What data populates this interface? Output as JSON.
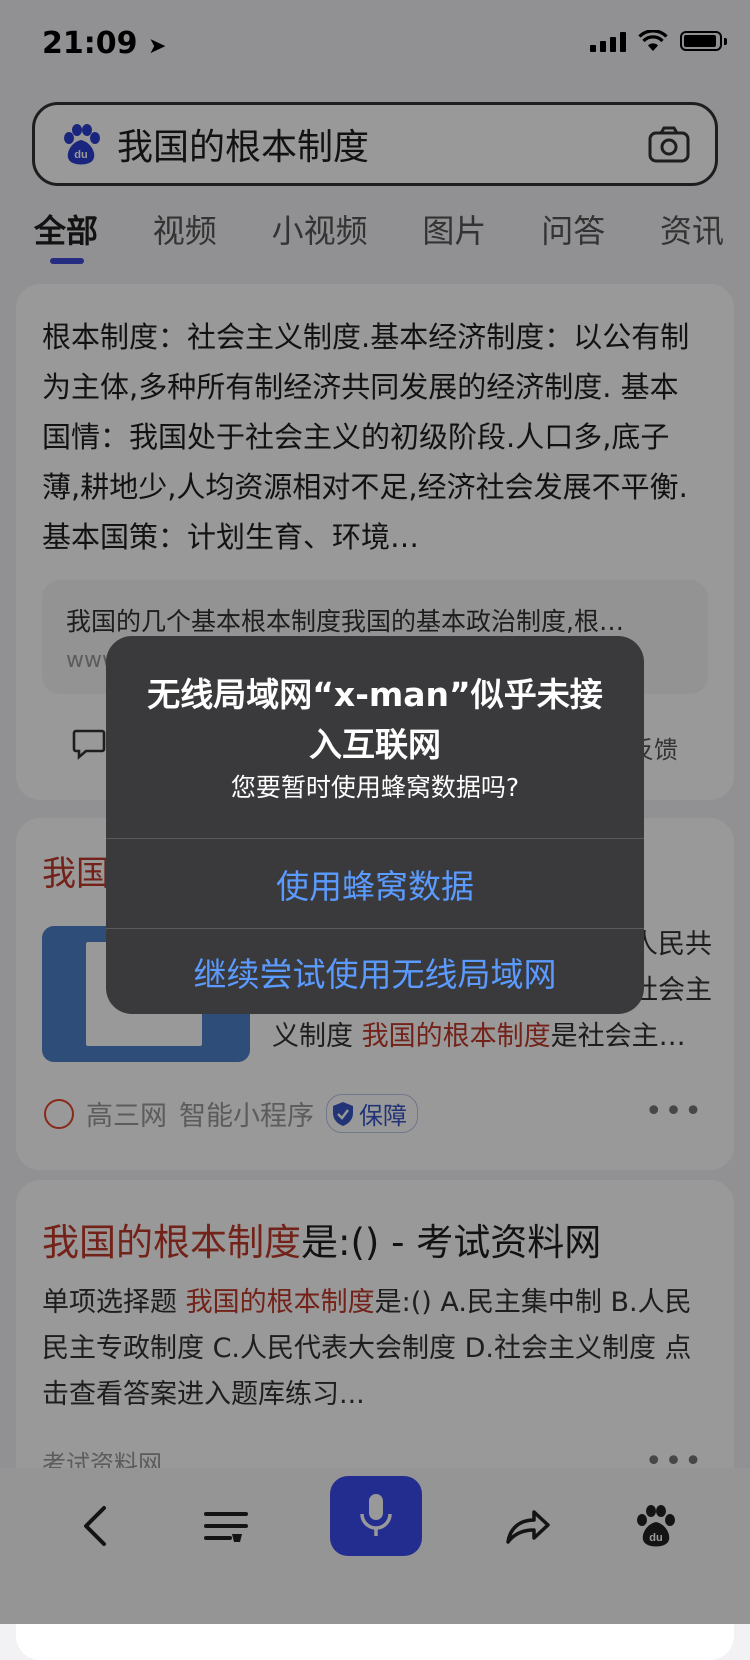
{
  "status_bar": {
    "time": "21:09"
  },
  "search": {
    "query": "我国的根本制度"
  },
  "tabs": [
    {
      "label": "全部"
    },
    {
      "label": "视频"
    },
    {
      "label": "小视频"
    },
    {
      "label": "图片"
    },
    {
      "label": "问答"
    },
    {
      "label": "资讯"
    }
  ],
  "result1": {
    "summary": "根本制度：社会主义制度.基本经济制度：以公有制为主体,多种所有制经济共同发展的经济制度. 基本国情：我国处于社会主义的初级阶段.人口多,底子薄,耕地少,人均资源相对不足,经济社会发展不平衡.基本国策：计划生育、环境…",
    "sub_text": "我国的几个基本根本制度我国的基本政治制度,根…",
    "sub_url": "www",
    "feedback": "反馈"
  },
  "result2": {
    "title": "我国",
    "line1": "人民共",
    "line2": "社会主",
    "line3_pre": "义制度 ",
    "line3_hl": "我国的根本制度",
    "line3_post": "是社会主…",
    "source": "高三网",
    "tag": "智能小程序",
    "badge": "保障",
    "more": "•••"
  },
  "result3": {
    "title_hl": "我国的根本制度",
    "title_rest": "是:() - 考试资料网",
    "body_pre": "单项选择题 ",
    "body_hl": "我国的根本制度",
    "body_rest": "是:() A.民主集中制 B.人民民主专政制度 C.人民代表大会制度 D.社会主义制度 点击查看答案进入题库练习...",
    "source": "考试资料网",
    "more": "•••"
  },
  "alert": {
    "title": "无线局域网“x-man”似乎未接入互联网",
    "message": "您要暂时使用蜂窝数据吗?",
    "button_primary": "使用蜂窝数据",
    "button_secondary": "继续尝试使用无线局域网"
  }
}
